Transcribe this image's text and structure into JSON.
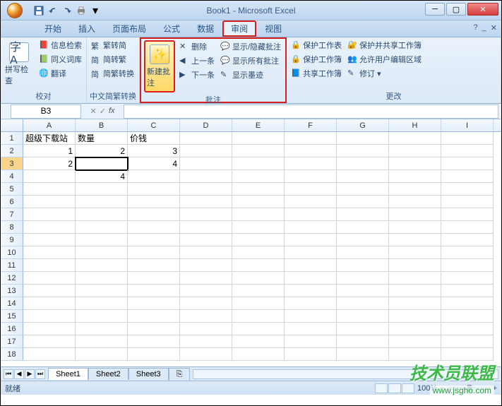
{
  "title": "Book1 - Microsoft Excel",
  "tabs": {
    "start": "开始",
    "insert": "插入",
    "layout": "页面布局",
    "formula": "公式",
    "data": "数据",
    "review": "审阅",
    "view": "视图"
  },
  "ribbon": {
    "proofing": {
      "spell": "拼写检查",
      "research": "信息检索",
      "thesaurus": "同义词库",
      "translate": "翻译",
      "label": "校对"
    },
    "chinese": {
      "sc": "繁转简",
      "tc": "简转繁",
      "conv": "简繁转换",
      "label": "中文简繁转换"
    },
    "comments": {
      "new": "新建批注",
      "delete": "删除",
      "prev": "上一条",
      "next": "下一条",
      "showhide": "显示/隐藏批注",
      "showall": "显示所有批注",
      "showink": "显示墨迹",
      "label": "批注"
    },
    "changes": {
      "protect_sheet": "保护工作表",
      "protect_book": "保护工作簿",
      "share": "共享工作簿",
      "protect_share": "保护并共享工作簿",
      "allow_edit": "允许用户编辑区域",
      "track": "修订",
      "label": "更改"
    }
  },
  "namebox": "B3",
  "columns": [
    "A",
    "B",
    "C",
    "D",
    "E",
    "F",
    "G",
    "H",
    "I"
  ],
  "rownums": [
    "1",
    "2",
    "3",
    "4",
    "5",
    "6",
    "7",
    "8",
    "9",
    "10",
    "11",
    "12",
    "13",
    "14",
    "15",
    "16",
    "17",
    "18"
  ],
  "cells": {
    "A1": "超级下载站",
    "B1": "数量",
    "C1": "价钱",
    "A2": "1",
    "B2": "2",
    "C2": "3",
    "A3": "2",
    "C3": "4",
    "B4": "4"
  },
  "selected_cell": "B3",
  "active_row": "3",
  "sheets": {
    "s1": "Sheet1",
    "s2": "Sheet2",
    "s3": "Sheet3"
  },
  "status": "就绪",
  "zoom": "100%",
  "watermark": {
    "text": "技术员联盟",
    "url": "www.jsgho.com"
  }
}
